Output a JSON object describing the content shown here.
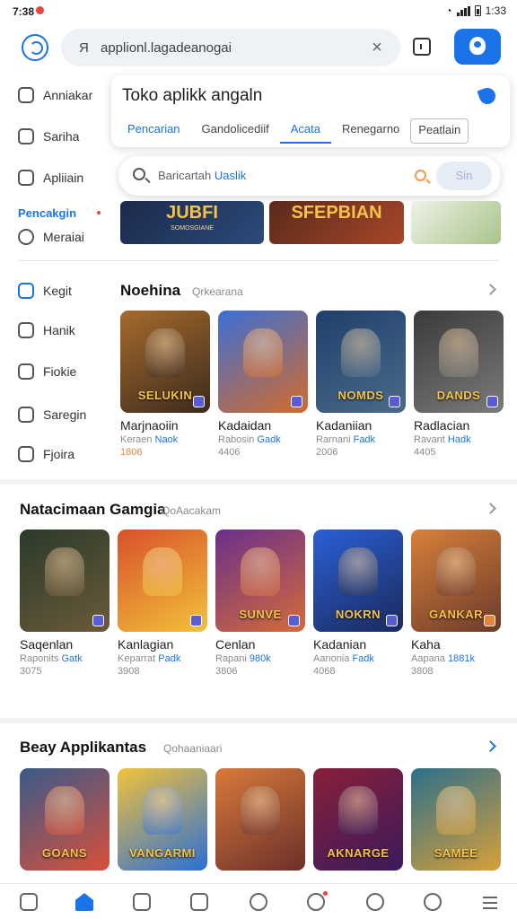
{
  "status": {
    "time": "7:38",
    "right_time": "1:33"
  },
  "topbar": {
    "query": "applionl.lagadeanogai"
  },
  "sidebar": {
    "items": [
      {
        "label": "Anniakar",
        "icon": "home-outline-icon"
      },
      {
        "label": "Sariha",
        "icon": "list-icon"
      },
      {
        "label": "Apliiain",
        "icon": "app-icon"
      },
      {
        "label": "Pencakgin",
        "icon": "",
        "active": true
      },
      {
        "label": "Meraiai",
        "icon": "shield-check-icon"
      },
      {
        "label": "Kegit",
        "icon": "chart-icon"
      },
      {
        "label": "Hanik",
        "icon": "message-icon"
      },
      {
        "label": "Fiokie",
        "icon": "settings-icon"
      },
      {
        "label": "Saregin",
        "icon": "tag-icon"
      },
      {
        "label": "Fjoira",
        "icon": "smile-icon"
      }
    ]
  },
  "store": {
    "title": "Toko aplikk angaln",
    "tabs": [
      "Pencarian",
      "Gandolicediif",
      "Acata",
      "Renegarno",
      "Peatlain"
    ]
  },
  "search": {
    "placeholder_a": "Baricartah",
    "placeholder_b": "Uaslik",
    "button": "Sin"
  },
  "banners": [
    {
      "title": "JUBFI",
      "sub": "SOMOSGIANE"
    },
    {
      "title": "SFEPBIAN",
      "sub": ""
    },
    {
      "title": "",
      "sub": ""
    }
  ],
  "sections": [
    {
      "title": "Noehina",
      "subtitle": "Qrkearana",
      "apps": [
        {
          "name": "Marjnaoiin",
          "dev": "Keraen",
          "dev2": "Naok",
          "rating": "1806",
          "art": "SELUKIN",
          "colors": [
            "#a66b2b",
            "#3b2a1e"
          ],
          "rating_color": "orange"
        },
        {
          "name": "Kadaidan",
          "dev": "Rabosin",
          "dev2": "Gadk",
          "rating": "4406",
          "art": "",
          "colors": [
            "#3b6fd6",
            "#d46b2a"
          ],
          "rating_color": "grey"
        },
        {
          "name": "Kadaniian",
          "dev": "Rarnani",
          "dev2": "Fadk",
          "rating": "2006",
          "art": "NOMDS",
          "colors": [
            "#1f3f6b",
            "#4a6b8a"
          ],
          "rating_color": "grey"
        },
        {
          "name": "Radlacian",
          "dev": "Ravant",
          "dev2": "Hadk",
          "rating": "4405",
          "art": "DANDS",
          "colors": [
            "#3a3a3a",
            "#7b7b7b"
          ],
          "rating_color": "grey"
        }
      ]
    },
    {
      "title": "Natacimaan   Gamgia",
      "subtitle": "QoAacakam",
      "apps": [
        {
          "name": "Saqenlan",
          "dev": "Raponits",
          "dev2": "Gatk",
          "rating": "3075",
          "art": "",
          "colors": [
            "#2a3a2a",
            "#6b5a3a"
          ],
          "rating_color": "grey"
        },
        {
          "name": "Kanlagian",
          "dev": "Keparrat",
          "dev2": "Padk",
          "rating": "3908",
          "art": "",
          "colors": [
            "#d8502a",
            "#f2c23a"
          ],
          "rating_color": "grey"
        },
        {
          "name": "Cenlan",
          "dev": "Rapani",
          "dev2": "980k",
          "rating": "3806",
          "art": "SUNVE",
          "colors": [
            "#6a2f8a",
            "#d46b3a"
          ],
          "rating_color": "grey"
        },
        {
          "name": "Kadanian",
          "dev": "Aanonia",
          "dev2": "Fadk",
          "rating": "4068",
          "art": "NOKRN",
          "colors": [
            "#2b5fd6",
            "#1a2a5b"
          ],
          "rating_color": "grey"
        },
        {
          "name": "Kaha",
          "dev": "Aapana",
          "dev2": "1881k",
          "rating": "3808",
          "art": "GANKAR",
          "colors": [
            "#d8803a",
            "#6b3a2a"
          ],
          "rating_color": "grey"
        }
      ]
    },
    {
      "title": "Beay   Applikantas",
      "subtitle": "Qohaaniaari",
      "apps": [
        {
          "art": "GOANS",
          "colors": [
            "#3a5a8a",
            "#d8503a"
          ]
        },
        {
          "art": "VANGARMI",
          "colors": [
            "#f2c23a",
            "#2b6fd6"
          ]
        },
        {
          "art": "",
          "colors": [
            "#d87a3a",
            "#6b2f2a"
          ]
        },
        {
          "art": "AKNARGE",
          "colors": [
            "#8a1f3a",
            "#3a1a5b"
          ]
        },
        {
          "art": "SAMEE",
          "colors": [
            "#2b6f8a",
            "#d8a03a"
          ]
        }
      ]
    }
  ],
  "colors": {
    "accent": "#1a73e8",
    "badge_orange": "#e8833a"
  }
}
